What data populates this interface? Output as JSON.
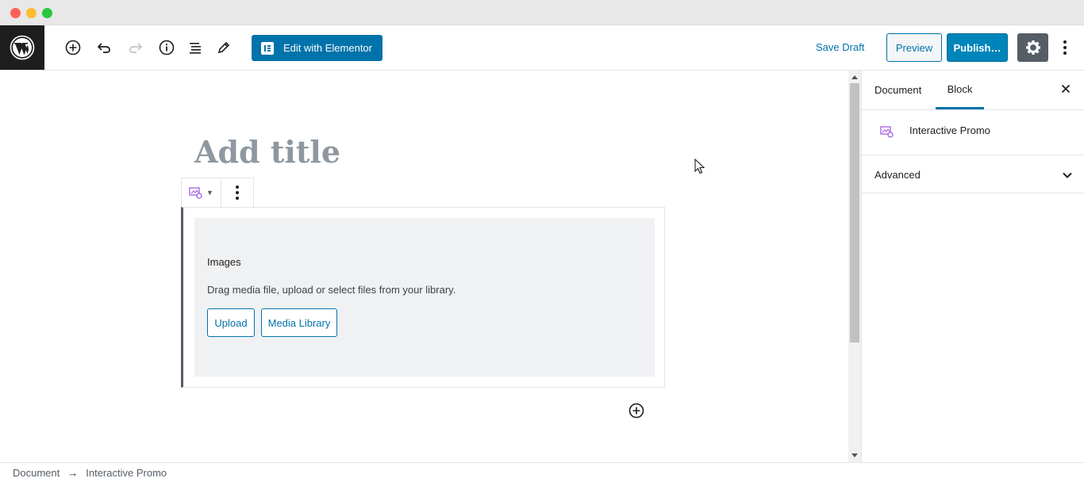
{
  "toolbar": {
    "add_block_icon": "plus-circle-icon",
    "undo_icon": "undo-icon",
    "redo_icon": "redo-icon",
    "info_icon": "info-icon",
    "outline_icon": "list-icon",
    "tools_icon": "pencil-icon",
    "elementor_label": "Edit with Elementor",
    "save_draft_label": "Save Draft",
    "preview_label": "Preview",
    "publish_label": "Publish…",
    "settings_icon": "gear-icon",
    "more_icon": "more-vertical-icon"
  },
  "editor": {
    "title_placeholder": "Add title",
    "block": {
      "heading": "Images",
      "instructions": "Drag media file, upload or select files from your library.",
      "upload_label": "Upload",
      "media_library_label": "Media Library"
    }
  },
  "sidebar": {
    "tabs": [
      "Document",
      "Block"
    ],
    "active_tab": "Block",
    "block_card_title": "Interactive Promo",
    "advanced_label": "Advanced"
  },
  "breadcrumb": {
    "root": "Document",
    "separator": "→",
    "current": "Interactive Promo"
  },
  "colors": {
    "accent": "#0073aa",
    "publish": "#0085ba",
    "dark": "#1e1e1e"
  }
}
